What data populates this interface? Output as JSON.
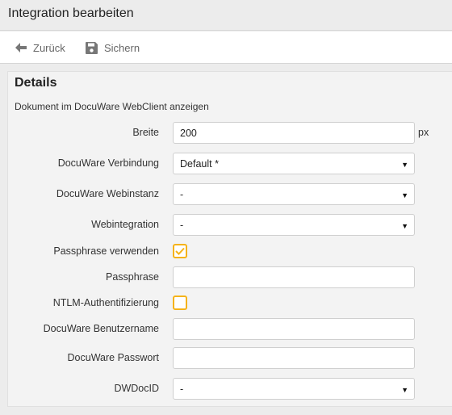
{
  "window": {
    "title": "Integration bearbeiten"
  },
  "toolbar": {
    "back_label": "Zurück",
    "save_label": "Sichern"
  },
  "details": {
    "heading": "Details",
    "subtitle": "Dokument im DocuWare WebClient anzeigen",
    "fields": {
      "breite": {
        "label": "Breite",
        "value": "200",
        "unit": "px"
      },
      "verbindung": {
        "label": "DocuWare Verbindung",
        "value": "Default *"
      },
      "webinstanz": {
        "label": "DocuWare Webinstanz",
        "value": "-"
      },
      "webintegration": {
        "label": "Webintegration",
        "value": "-"
      },
      "passphrase_verwenden": {
        "label": "Passphrase verwenden",
        "checked": true
      },
      "passphrase": {
        "label": "Passphrase",
        "value": ""
      },
      "ntlm": {
        "label": "NTLM-Authentifizierung",
        "checked": false
      },
      "benutzername": {
        "label": "DocuWare Benutzername",
        "value": ""
      },
      "passwort": {
        "label": "DocuWare Passwort",
        "value": ""
      },
      "dwdocid": {
        "label": "DWDocID",
        "value": "-"
      }
    }
  },
  "colors": {
    "accent": "#f5b31a",
    "toolbar_text": "#666666",
    "background": "#ececec"
  },
  "icons": {
    "back": "arrow-left-icon",
    "save": "floppy-disk-icon",
    "dropdown": "caret-down-icon",
    "checked": "checkmark-icon"
  }
}
